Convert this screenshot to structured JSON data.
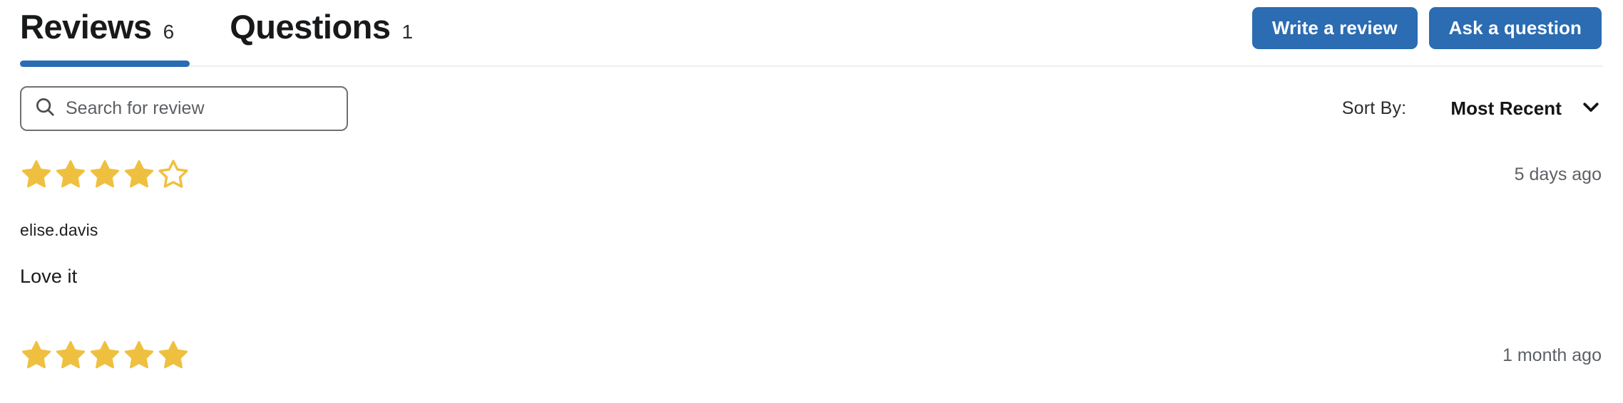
{
  "tabs": [
    {
      "label": "Reviews",
      "count": "6",
      "active": true,
      "name": "tab-reviews"
    },
    {
      "label": "Questions",
      "count": "1",
      "active": false,
      "name": "tab-questions"
    }
  ],
  "header": {
    "write_review_label": "Write a review",
    "ask_question_label": "Ask a question"
  },
  "search": {
    "placeholder": "Search for review",
    "value": "",
    "icon": "search-icon"
  },
  "sort": {
    "label": "Sort By:",
    "value": "Most Recent",
    "icon": "chevron-down-icon",
    "options": [
      "Most Recent"
    ]
  },
  "reviews": [
    {
      "rating": 4,
      "max_rating": 5,
      "time": "5 days ago",
      "author": "elise.davis",
      "body": "Love it"
    },
    {
      "rating": 5,
      "max_rating": 5,
      "time": "1 month ago",
      "author": "",
      "body": ""
    }
  ],
  "colors": {
    "accent_blue": "#2b6cb2",
    "star_gold": "#efc040",
    "divider": "#eceef0",
    "text_primary": "#18191a",
    "text_muted": "#5d6166"
  }
}
